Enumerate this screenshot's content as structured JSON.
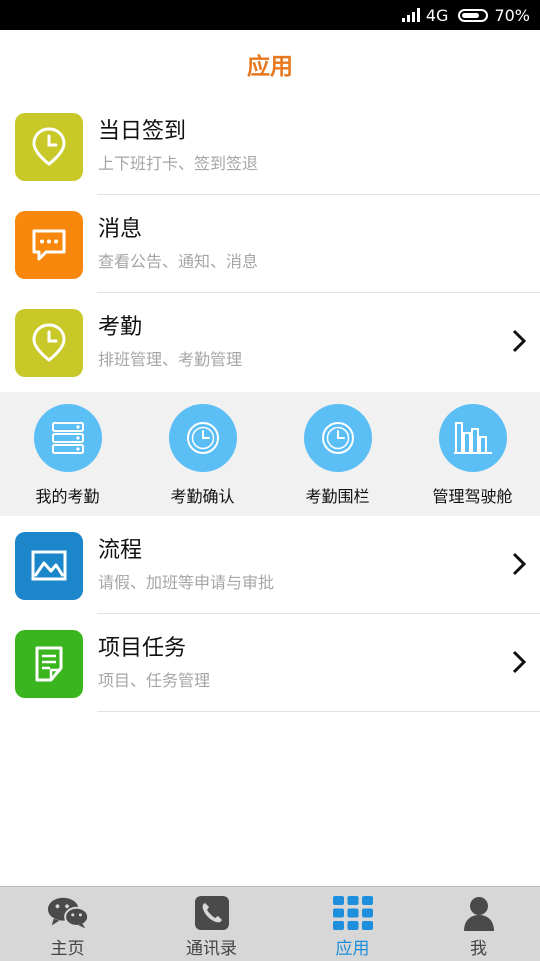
{
  "status_bar": {
    "network": "4G",
    "battery": "70%"
  },
  "header": {
    "title": "应用"
  },
  "rows_top": [
    {
      "title": "当日签到",
      "subtitle": "上下班打卡、签到签退",
      "icon": "location-clock-icon",
      "color": "#c8c829"
    },
    {
      "title": "消息",
      "subtitle": "查看公告、通知、消息",
      "icon": "message-icon",
      "color": "#f7880d"
    },
    {
      "title": "考勤",
      "subtitle": "排班管理、考勤管理",
      "icon": "location-clock-icon",
      "color": "#c8c829"
    }
  ],
  "attendance_grid": [
    {
      "label": "我的考勤",
      "icon": "server-list-icon"
    },
    {
      "label": "考勤确认",
      "icon": "clock-icon"
    },
    {
      "label": "考勤围栏",
      "icon": "clock-icon"
    },
    {
      "label": "管理驾驶舱",
      "icon": "building-chart-icon"
    }
  ],
  "rows_bottom": [
    {
      "title": "流程",
      "subtitle": "请假、加班等申请与审批",
      "icon": "image-frame-icon",
      "color": "#1b86c9"
    },
    {
      "title": "项目任务",
      "subtitle": "项目、任务管理",
      "icon": "document-edit-icon",
      "color": "#3ab51d"
    }
  ],
  "tabs": [
    {
      "label": "主页",
      "icon": "chat-bubbles-icon"
    },
    {
      "label": "通讯录",
      "icon": "phone-icon"
    },
    {
      "label": "应用",
      "icon": "apps-grid-icon",
      "active": true
    },
    {
      "label": "我",
      "icon": "person-icon"
    }
  ],
  "colors": {
    "accent_title": "#e8781e",
    "active_tab": "#1d8fdc",
    "grid_circle": "#5bbef4"
  }
}
